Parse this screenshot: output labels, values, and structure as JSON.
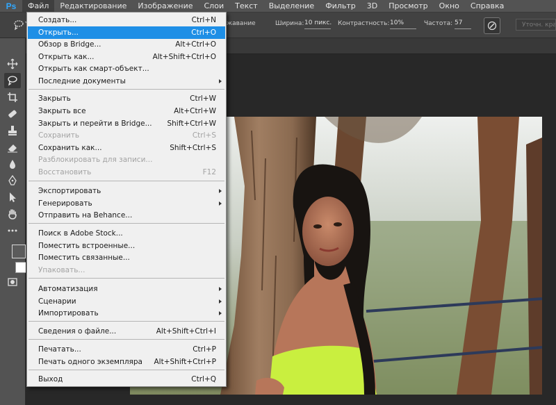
{
  "app": {
    "logo": "Ps",
    "accent": "#31a8ff",
    "highlight": "#1e8fe6"
  },
  "menubar": {
    "items": [
      {
        "label": "Файл"
      },
      {
        "label": "Редактирование"
      },
      {
        "label": "Изображение"
      },
      {
        "label": "Слои"
      },
      {
        "label": "Текст"
      },
      {
        "label": "Выделение"
      },
      {
        "label": "Фильтр"
      },
      {
        "label": "3D"
      },
      {
        "label": "Просмотр"
      },
      {
        "label": "Окно"
      },
      {
        "label": "Справка"
      }
    ]
  },
  "options": {
    "mode_label": "жавание",
    "width_label": "Ширина:",
    "width_value": "10 пикс.",
    "contrast_label": "Контрастность:",
    "contrast_value": "10%",
    "frequency_label": "Частота:",
    "frequency_value": "57",
    "refine_label": "Уточн. край...",
    "tool_icon": "magnetic-lasso-icon",
    "pressure_icon": "tablet-pressure-icon"
  },
  "tools": [
    "move-icon",
    "lasso-icon",
    "crop-icon",
    "healing-brush-icon",
    "stamp-icon",
    "eraser-icon",
    "blur-icon",
    "pen-icon",
    "path-selection-icon",
    "hand-icon",
    "more-tools-icon",
    "quick-mask-icon"
  ],
  "file_menu": {
    "items": [
      {
        "label": "Создать...",
        "shortcut": "Ctrl+N"
      },
      {
        "label": "Открыть...",
        "shortcut": "Ctrl+O",
        "highlighted": true
      },
      {
        "label": "Обзор в Bridge...",
        "shortcut": "Alt+Ctrl+O"
      },
      {
        "label": "Открыть как...",
        "shortcut": "Alt+Shift+Ctrl+O"
      },
      {
        "label": "Открыть как смарт-объект...",
        "shortcut": ""
      },
      {
        "label": "Последние документы",
        "shortcut": "",
        "submenu": true
      },
      {
        "label": "Закрыть",
        "shortcut": "Ctrl+W"
      },
      {
        "label": "Закрыть все",
        "shortcut": "Alt+Ctrl+W"
      },
      {
        "label": "Закрыть и перейти в Bridge...",
        "shortcut": "Shift+Ctrl+W"
      },
      {
        "label": "Сохранить",
        "shortcut": "Ctrl+S",
        "disabled": true
      },
      {
        "label": "Сохранить как...",
        "shortcut": "Shift+Ctrl+S"
      },
      {
        "label": "Разблокировать для записи...",
        "shortcut": "",
        "disabled": true
      },
      {
        "label": "Восстановить",
        "shortcut": "F12",
        "disabled": true
      },
      {
        "label": "Экспортировать",
        "shortcut": "",
        "submenu": true
      },
      {
        "label": "Генерировать",
        "shortcut": "",
        "submenu": true
      },
      {
        "label": "Отправить на Behance...",
        "shortcut": ""
      },
      {
        "label": "Поиск в Adobe Stock...",
        "shortcut": ""
      },
      {
        "label": "Поместить встроенные...",
        "shortcut": ""
      },
      {
        "label": "Поместить связанные...",
        "shortcut": ""
      },
      {
        "label": "Упаковать...",
        "shortcut": "",
        "disabled": true
      },
      {
        "label": "Автоматизация",
        "shortcut": "",
        "submenu": true
      },
      {
        "label": "Сценарии",
        "shortcut": "",
        "submenu": true
      },
      {
        "label": "Импортировать",
        "shortcut": "",
        "submenu": true
      },
      {
        "label": "Сведения о файле...",
        "shortcut": "Alt+Shift+Ctrl+I"
      },
      {
        "label": "Печатать...",
        "shortcut": "Ctrl+P"
      },
      {
        "label": "Печать одного экземпляра",
        "shortcut": "Alt+Shift+Ctrl+P"
      },
      {
        "label": "Выход",
        "shortcut": "Ctrl+Q"
      }
    ]
  }
}
